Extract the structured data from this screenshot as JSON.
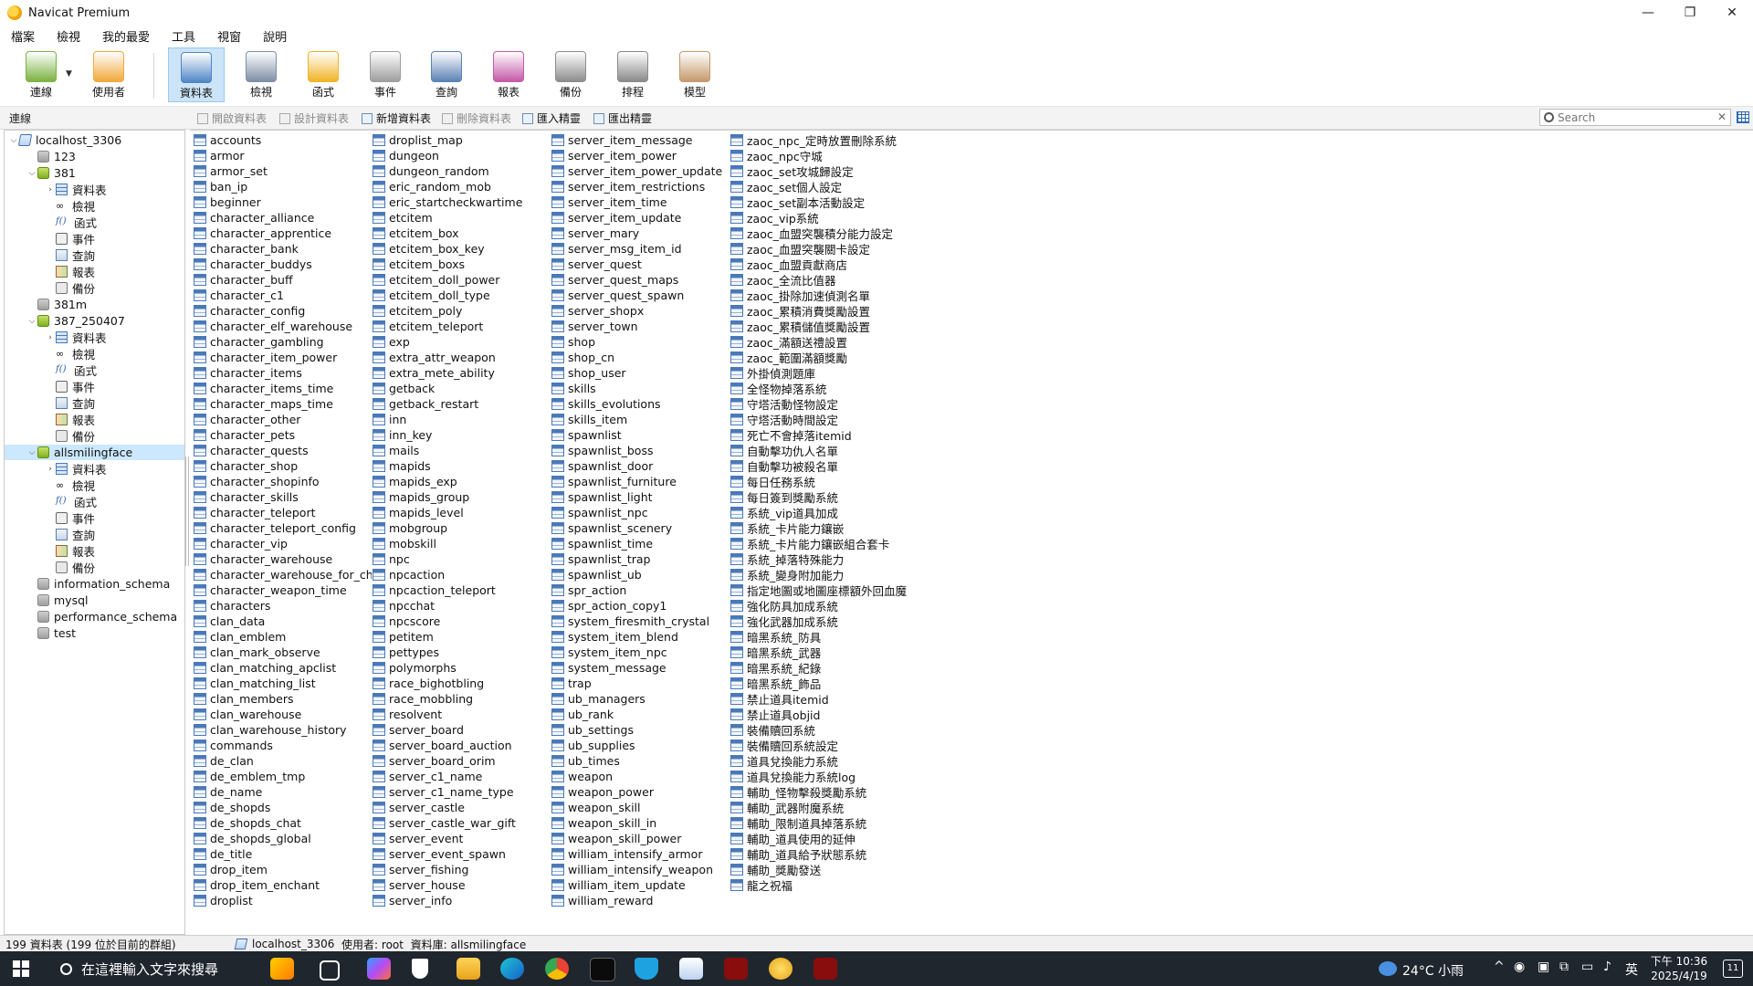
{
  "window": {
    "title": "Navicat Premium",
    "controls": [
      "—",
      "❐",
      "✕"
    ]
  },
  "menu": [
    "檔案",
    "檢視",
    "我的最愛",
    "工具",
    "視窗",
    "說明"
  ],
  "toolbar": [
    {
      "label": "連線",
      "color": "#7cb342"
    },
    {
      "label": "使用者",
      "color": "#f2a93b"
    },
    {
      "label": "資料表",
      "color": "#4f86c6"
    },
    {
      "label": "檢視",
      "color": "#7f8fa6"
    },
    {
      "label": "函式",
      "color": "#f0b428"
    },
    {
      "label": "事件",
      "color": "#9e9e9e"
    },
    {
      "label": "查詢",
      "color": "#5b82b5"
    },
    {
      "label": "報表",
      "color": "#c45aa8"
    },
    {
      "label": "備份",
      "color": "#8d8d8d"
    },
    {
      "label": "排程",
      "color": "#8a8a8a"
    },
    {
      "label": "模型",
      "color": "#c49a6c"
    }
  ],
  "subtoolbar": {
    "connection_label": "連線",
    "buttons": [
      "開啟資料表",
      "設計資料表",
      "新增資料表",
      "刪除資料表",
      "匯入精靈",
      "匯出精靈"
    ],
    "search_placeholder": "Search"
  },
  "tree": [
    {
      "label": "localhost_3306",
      "icon": "server",
      "depth": 0,
      "arrow": "v"
    },
    {
      "label": "123",
      "icon": "db-gray",
      "depth": 1,
      "arrow": ""
    },
    {
      "label": "381",
      "icon": "db-green",
      "depth": 1,
      "arrow": "v"
    },
    {
      "label": "資料表",
      "icon": "tables",
      "depth": 2,
      "arrow": ">"
    },
    {
      "label": "檢視",
      "icon": "views",
      "depth": 2,
      "arrow": ""
    },
    {
      "label": "函式",
      "icon": "func",
      "depth": 2,
      "arrow": ""
    },
    {
      "label": "事件",
      "icon": "event",
      "depth": 2,
      "arrow": ""
    },
    {
      "label": "查詢",
      "icon": "query",
      "depth": 2,
      "arrow": ""
    },
    {
      "label": "報表",
      "icon": "report",
      "depth": 2,
      "arrow": ""
    },
    {
      "label": "備份",
      "icon": "backup",
      "depth": 2,
      "arrow": ""
    },
    {
      "label": "381m",
      "icon": "db-gray",
      "depth": 1,
      "arrow": ""
    },
    {
      "label": "387_250407",
      "icon": "db-green",
      "depth": 1,
      "arrow": "v"
    },
    {
      "label": "資料表",
      "icon": "tables",
      "depth": 2,
      "arrow": ">"
    },
    {
      "label": "檢視",
      "icon": "views",
      "depth": 2,
      "arrow": ""
    },
    {
      "label": "函式",
      "icon": "func",
      "depth": 2,
      "arrow": ""
    },
    {
      "label": "事件",
      "icon": "event",
      "depth": 2,
      "arrow": ""
    },
    {
      "label": "查詢",
      "icon": "query",
      "depth": 2,
      "arrow": ""
    },
    {
      "label": "報表",
      "icon": "report",
      "depth": 2,
      "arrow": ""
    },
    {
      "label": "備份",
      "icon": "backup",
      "depth": 2,
      "arrow": ""
    },
    {
      "label": "allsmilingface",
      "icon": "db-green",
      "depth": 1,
      "arrow": "v",
      "selected": true
    },
    {
      "label": "資料表",
      "icon": "tables",
      "depth": 2,
      "arrow": ">"
    },
    {
      "label": "檢視",
      "icon": "views",
      "depth": 2,
      "arrow": ""
    },
    {
      "label": "函式",
      "icon": "func",
      "depth": 2,
      "arrow": ""
    },
    {
      "label": "事件",
      "icon": "event",
      "depth": 2,
      "arrow": ""
    },
    {
      "label": "查詢",
      "icon": "query",
      "depth": 2,
      "arrow": ""
    },
    {
      "label": "報表",
      "icon": "report",
      "depth": 2,
      "arrow": ""
    },
    {
      "label": "備份",
      "icon": "backup",
      "depth": 2,
      "arrow": ""
    },
    {
      "label": "information_schema",
      "icon": "db-gray",
      "depth": 1,
      "arrow": ""
    },
    {
      "label": "mysql",
      "icon": "db-gray",
      "depth": 1,
      "arrow": ""
    },
    {
      "label": "performance_schema",
      "icon": "db-gray",
      "depth": 1,
      "arrow": ""
    },
    {
      "label": "test",
      "icon": "db-gray",
      "depth": 1,
      "arrow": ""
    }
  ],
  "tables": [
    [
      "accounts",
      "armor",
      "armor_set",
      "ban_ip",
      "beginner",
      "character_alliance",
      "character_apprentice",
      "character_bank",
      "character_buddys",
      "character_buff",
      "character_c1",
      "character_config",
      "character_elf_warehouse",
      "character_gambling",
      "character_item_power",
      "character_items",
      "character_items_time",
      "character_maps_time",
      "character_other",
      "character_pets",
      "character_quests",
      "character_shop",
      "character_shopinfo",
      "character_skills",
      "character_teleport",
      "character_teleport_config",
      "character_vip",
      "character_warehouse",
      "character_warehouse_for_cha",
      "character_weapon_time",
      "characters",
      "clan_data",
      "clan_emblem",
      "clan_mark_observe",
      "clan_matching_apclist",
      "clan_matching_list",
      "clan_members",
      "clan_warehouse",
      "clan_warehouse_history",
      "commands",
      "de_clan",
      "de_emblem_tmp",
      "de_name",
      "de_shopds",
      "de_shopds_chat",
      "de_shopds_global",
      "de_title",
      "drop_item",
      "drop_item_enchant",
      "droplist"
    ],
    [
      "droplist_map",
      "dungeon",
      "dungeon_random",
      "eric_random_mob",
      "eric_startcheckwartime",
      "etcitem",
      "etcitem_box",
      "etcitem_box_key",
      "etcitem_boxs",
      "etcitem_doll_power",
      "etcitem_doll_type",
      "etcitem_poly",
      "etcitem_teleport",
      "exp",
      "extra_attr_weapon",
      "extra_mete_ability",
      "getback",
      "getback_restart",
      "inn",
      "inn_key",
      "mails",
      "mapids",
      "mapids_exp",
      "mapids_group",
      "mapids_level",
      "mobgroup",
      "mobskill",
      "npc",
      "npcaction",
      "npcaction_teleport",
      "npcchat",
      "npcscore",
      "petitem",
      "pettypes",
      "polymorphs",
      "race_bighotbling",
      "race_mobbling",
      "resolvent",
      "server_board",
      "server_board_auction",
      "server_board_orim",
      "server_c1_name",
      "server_c1_name_type",
      "server_castle",
      "server_castle_war_gift",
      "server_event",
      "server_event_spawn",
      "server_fishing",
      "server_house",
      "server_info"
    ],
    [
      "server_item_message",
      "server_item_power",
      "server_item_power_update",
      "server_item_restrictions",
      "server_item_time",
      "server_item_update",
      "server_mary",
      "server_msg_item_id",
      "server_quest",
      "server_quest_maps",
      "server_quest_spawn",
      "server_shopx",
      "server_town",
      "shop",
      "shop_cn",
      "shop_user",
      "skills",
      "skills_evolutions",
      "skills_item",
      "spawnlist",
      "spawnlist_boss",
      "spawnlist_door",
      "spawnlist_furniture",
      "spawnlist_light",
      "spawnlist_npc",
      "spawnlist_scenery",
      "spawnlist_time",
      "spawnlist_trap",
      "spawnlist_ub",
      "spr_action",
      "spr_action_copy1",
      "system_firesmith_crystal",
      "system_item_blend",
      "system_item_npc",
      "system_message",
      "trap",
      "ub_managers",
      "ub_rank",
      "ub_settings",
      "ub_supplies",
      "ub_times",
      "weapon",
      "weapon_power",
      "weapon_skill",
      "weapon_skill_in",
      "weapon_skill_power",
      "william_intensify_armor",
      "william_intensify_weapon",
      "william_item_update",
      "william_reward"
    ],
    [
      "zaoc_npc_定時放置刪除系統",
      "zaoc_npc守城",
      "zaoc_set攻城歸設定",
      "zaoc_set個人設定",
      "zaoc_set副本活動設定",
      "zaoc_vip系統",
      "zaoc_血盟突襲積分能力設定",
      "zaoc_血盟突襲關卡設定",
      "zaoc_血盟貢獻商店",
      "zaoc_全流比值器",
      "zaoc_掛除加速偵測名單",
      "zaoc_累積消費獎勵設置",
      "zaoc_累積儲值獎勵設置",
      "zaoc_滿額送禮設置",
      "zaoc_範圍滿額獎勵",
      "外掛偵測題庫",
      "全怪物掉落系統",
      "守塔活動怪物設定",
      "守塔活動時間設定",
      "死亡不會掉落itemid",
      "自動擊功仇人名單",
      "自動擊功被殺名單",
      "每日任務系統",
      "每日簽到獎勵系統",
      "系統_vip道具加成",
      "系統_卡片能力鑲嵌",
      "系統_卡片能力鑲嵌組合套卡",
      "系統_掉落特殊能力",
      "系統_變身附加能力",
      "指定地圖或地圖座標額外回血魔",
      "強化防具加成系統",
      "強化武器加成系統",
      "暗黑系統_防具",
      "暗黑系統_武器",
      "暗黑系統_紀錄",
      "暗黑系統_飾品",
      "禁止道具itemid",
      "禁止道具objid",
      "裝備贖回系統",
      "裝備贖回系統設定",
      "道具兌換能力系統",
      "道具兌換能力系統log",
      "輔助_怪物擊殺獎勵系統",
      "輔助_武器附魔系統",
      "輔助_限制道具掉落系統",
      "輔助_道具使用的延伸",
      "輔助_道具給予狀態系統",
      "輔助_獎勵發送",
      "龍之祝福"
    ]
  ],
  "statusbar": {
    "count": "199 資料表 (199 位於目前的群組)",
    "connection": "localhost_3306",
    "user": "使用者: root",
    "database": "資料庫: allsmilingface"
  },
  "taskbar": {
    "search_text": "在這裡輸入文字來搜尋",
    "weather": "24°C 小雨",
    "ime": "英",
    "time": "下午 10:36",
    "date": "2025/4/19",
    "notifications": "11"
  }
}
